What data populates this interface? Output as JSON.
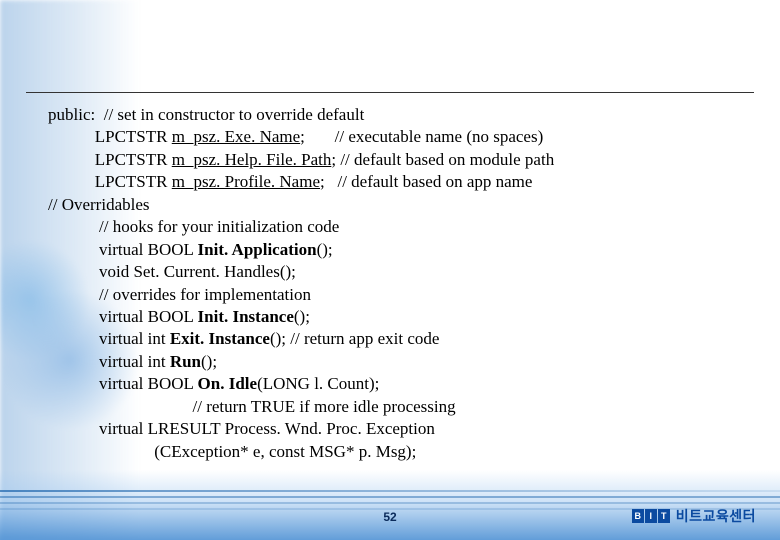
{
  "code": {
    "l01a": "public:  // set in constructor to override default",
    "l02a": "           LPCTSTR ",
    "l02b": "m_psz. Exe. Name",
    "l02c": ";       // executable name (no spaces)",
    "l03a": "           LPCTSTR ",
    "l03b": "m_psz. Help. File. Path",
    "l03c": "; // default based on module path",
    "l04a": "           LPCTSTR ",
    "l04b": "m_psz. Profile. Name",
    "l04c": ";   // default based on app name",
    "l05a": "// Overridables",
    "l06a": "            // hooks for your initialization code",
    "l07a": "            virtual BOOL ",
    "l07b": "Init. Application",
    "l07c": "();",
    "l08a": "            void Set. Current. Handles();",
    "l09a": "            // overrides for implementation",
    "l10a": "            virtual BOOL ",
    "l10b": "Init. Instance",
    "l10c": "();",
    "l11a": "            virtual int ",
    "l11b": "Exit. Instance",
    "l11c": "(); // return app exit code",
    "l12a": "            virtual int ",
    "l12b": "Run",
    "l12c": "();",
    "l13a": "            virtual BOOL ",
    "l13b": "On. Idle",
    "l13c": "(LONG l. Count);",
    "l14a": "                                  // return TRUE if more idle processing",
    "l15a": "            virtual LRESULT Process. Wnd. Proc. Exception",
    "l16a": "                         (CException* e, const MSG* p. Msg);"
  },
  "page_number": "52",
  "footer": {
    "logo_letters": [
      "B",
      "I",
      "T"
    ],
    "text": "비트교육센터"
  }
}
